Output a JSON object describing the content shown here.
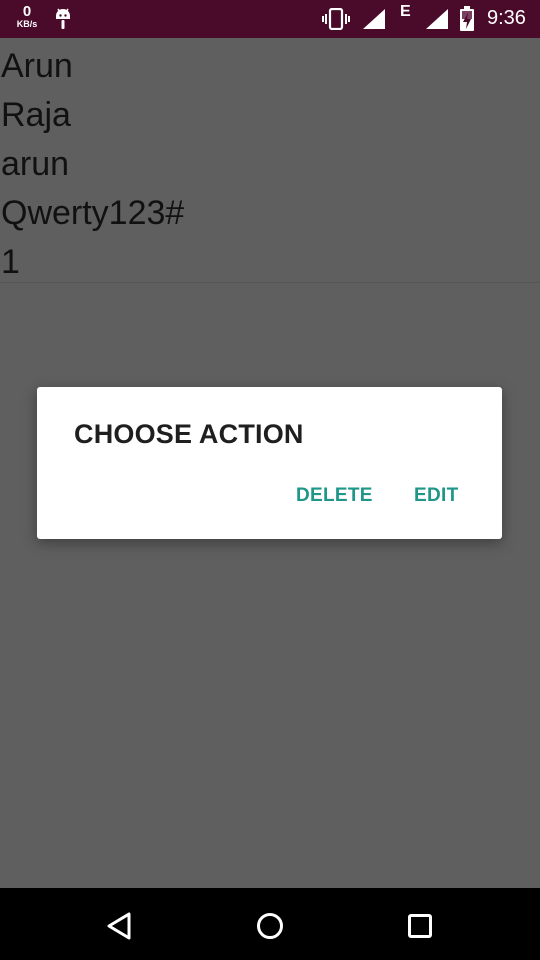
{
  "status_bar": {
    "net_speed_value": "0",
    "net_speed_unit": "KB/s",
    "network_type": "E",
    "time": "9:36",
    "icons": [
      "android-debug-icon",
      "vibrate-icon",
      "signal-icon",
      "battery-charging-icon"
    ]
  },
  "record": {
    "lines": [
      "Arun",
      "Raja",
      "arun",
      "Qwerty123#",
      "1"
    ]
  },
  "dialog": {
    "title": "CHOOSE ACTION",
    "delete_label": "DELETE",
    "edit_label": "EDIT",
    "accent_color": "#1e9688"
  },
  "nav_bar": {
    "icons": [
      "back-icon",
      "home-icon",
      "recents-icon"
    ]
  }
}
